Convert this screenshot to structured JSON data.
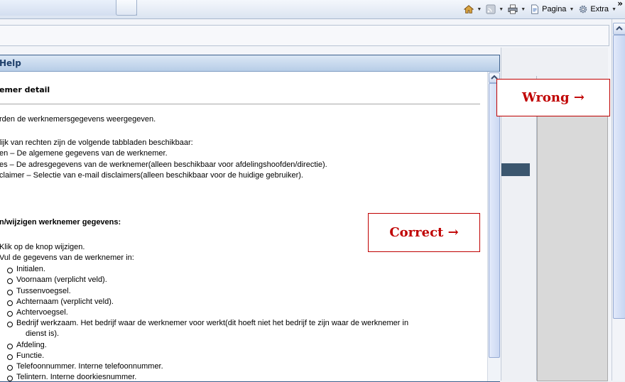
{
  "toolbar": {
    "home_icon": "home-icon",
    "feeds_icon": "rss-icon",
    "print_icon": "printer-icon",
    "page_label": "Pagina",
    "extra_label": "Extra",
    "more": "»"
  },
  "help": {
    "title": "Help",
    "heading": "emer detail",
    "intro": "rden de werknemersgegevens weergegeven.",
    "rights_intro": "lijk van rechten zijn de volgende tabbladen beschikbaar:",
    "tabs": [
      "en – De algemene gegevens van de werknemer.",
      "es – De adresgegevens van de werknemer(alleen beschikbaar voor afdelingshoofden/directie).",
      "claimer – Selectie van e-mail disclaimers(alleen beschikbaar voor de huidige gebruiker)."
    ],
    "section_title": "n/wijzigen werknemer gegevens:",
    "step1": "Klik op de knop wijzigen.",
    "step2": "Vul de gegevens van de werknemer in:",
    "fields": [
      "Initialen.",
      "Voornaam (verplicht veld).",
      "Tussenvoegsel.",
      "Achternaam (verplicht veld).",
      "Achtervoegsel.",
      "Bedrijf werkzaam. Het bedrijf waar de werknemer voor werkt(dit hoeft niet het bedrijf te zijn waar de werknemer in",
      "Afdeling.",
      "Functie.",
      "Telefoonnummer. Interne telefoonnummer.",
      "Telintern. Interne doorkiesnummer."
    ],
    "field_continuation": "dienst is)."
  },
  "annotations": {
    "wrong": "Wrong →",
    "correct": "Correct →"
  },
  "colors": {
    "annotation": "#c00000",
    "help_title": "#1e3f6a"
  }
}
